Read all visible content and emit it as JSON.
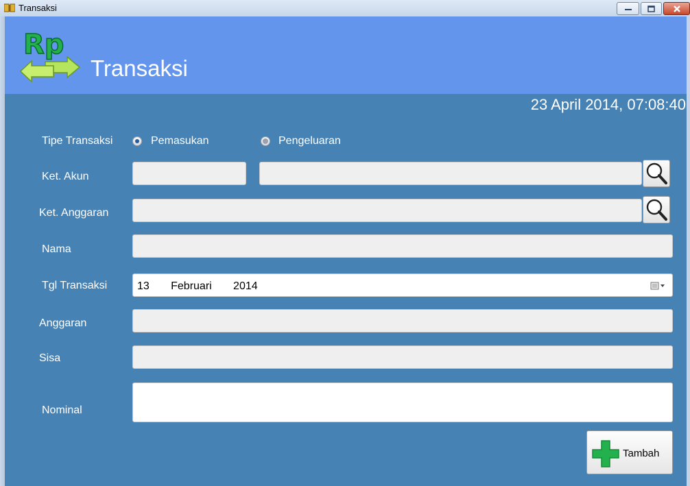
{
  "window": {
    "title": "Transaksi",
    "controls": [
      "minimize",
      "maximize",
      "close"
    ]
  },
  "header": {
    "logo_text": "Rp",
    "title": "Transaksi",
    "color": "#6495ed"
  },
  "form": {
    "background": "#4682b4",
    "datetime": "23 April 2014, 07:08:40",
    "tipe_transaksi": {
      "label": "Tipe Transaksi",
      "options": [
        {
          "label": "Pemasukan",
          "selected": true
        },
        {
          "label": "Pengeluaran",
          "selected": false
        }
      ]
    },
    "ket_akun": {
      "label": "Ket. Akun",
      "code_value": "",
      "name_value": ""
    },
    "ket_anggaran": {
      "label": "Ket. Anggaran",
      "value": ""
    },
    "nama": {
      "label": "Nama",
      "value": ""
    },
    "tgl_transaksi": {
      "label": "Tgl Transaksi",
      "value": "13   Februari   2014"
    },
    "anggaran": {
      "label": "Anggaran",
      "value": ""
    },
    "sisa": {
      "label": "Sisa",
      "value": ""
    },
    "nominal": {
      "label": "Nominal",
      "value": ""
    },
    "add_button": {
      "label": "Tambah",
      "icon": "plus-icon",
      "icon_color": "#22b14c"
    }
  }
}
